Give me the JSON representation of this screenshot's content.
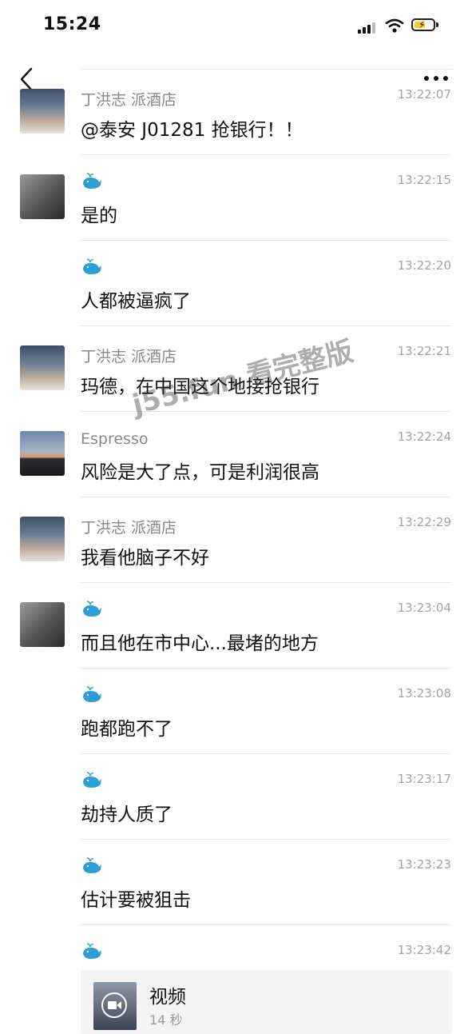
{
  "status_bar": {
    "time": "15:24"
  },
  "messages": [
    {
      "sender": "丁洪志 派酒店",
      "time": "13:22:07",
      "text": "@泰安 J01281 抢银行！！",
      "avatar": "couple"
    },
    {
      "sender": "",
      "time": "13:22:15",
      "text": "是的",
      "avatar": "bw"
    },
    {
      "sender": "",
      "time": "13:22:20",
      "text": "人都被逼疯了",
      "avatar": ""
    },
    {
      "sender": "丁洪志 派酒店",
      "time": "13:22:21",
      "text": "玛德，在中国这个地接抢银行",
      "avatar": "couple"
    },
    {
      "sender": "Espresso",
      "time": "13:22:24",
      "text": "风险是大了点，可是利润很高",
      "avatar": "sunset"
    },
    {
      "sender": "丁洪志 派酒店",
      "time": "13:22:29",
      "text": "我看他脑子不好",
      "avatar": "couple"
    },
    {
      "sender": "",
      "time": "13:23:04",
      "text": "而且他在市中心...最堵的地方",
      "avatar": "bw"
    },
    {
      "sender": "",
      "time": "13:23:08",
      "text": "跑都跑不了",
      "avatar": ""
    },
    {
      "sender": "",
      "time": "13:23:17",
      "text": "劫持人质了",
      "avatar": ""
    },
    {
      "sender": "",
      "time": "13:23:23",
      "text": "估计要被狙击",
      "avatar": ""
    }
  ],
  "video_message": {
    "time": "13:23:42",
    "title": "视频",
    "duration": "14 秒"
  },
  "watermark": "j55.fun 看完整版",
  "colors": {
    "accent_whale": "#2b9ed6",
    "divider": "#e6e6e6",
    "timestamp": "#a3a3a3"
  }
}
